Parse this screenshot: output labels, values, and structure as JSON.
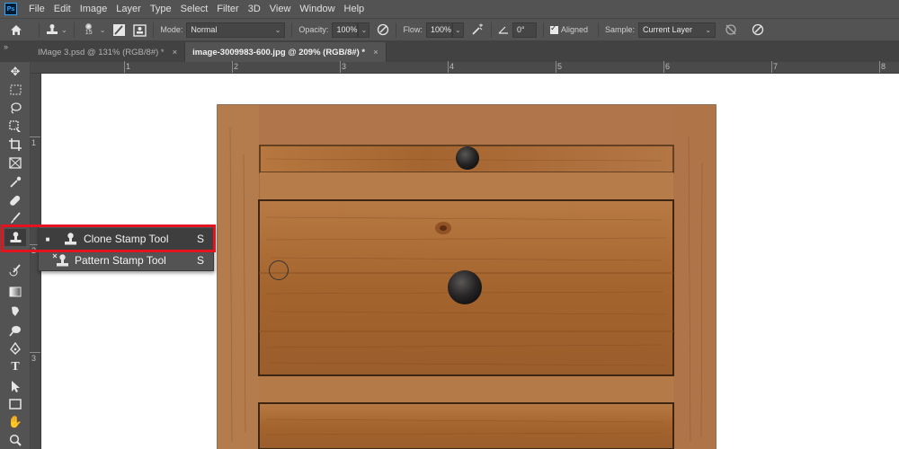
{
  "app": {
    "logo_text": "Ps"
  },
  "menu": [
    "File",
    "Edit",
    "Image",
    "Layer",
    "Type",
    "Select",
    "Filter",
    "3D",
    "View",
    "Window",
    "Help"
  ],
  "options": {
    "brush_size": "15",
    "mode_label": "Mode:",
    "mode_value": "Normal",
    "opacity_label": "Opacity:",
    "opacity_value": "100%",
    "flow_label": "Flow:",
    "flow_value": "100%",
    "angle_value": "0°",
    "aligned_label": "Aligned",
    "sample_label": "Sample:",
    "sample_value": "Current Layer"
  },
  "tabs": [
    {
      "label": "IMage 3.psd @ 131% (RGB/8#) *",
      "close": "×",
      "active": false
    },
    {
      "label": "image-3009983-600.jpg @ 209% (RGB/8#) *",
      "close": "×",
      "active": true
    }
  ],
  "tab_collapse": "»",
  "ruler": {
    "h_labels": [
      "1",
      "2",
      "3",
      "4",
      "5",
      "6",
      "7",
      "8"
    ],
    "v_labels": [
      "1",
      "2",
      "3"
    ]
  },
  "flyout": {
    "items": [
      {
        "mark": "■",
        "label": "Clone Stamp Tool",
        "shortcut": "S"
      },
      {
        "mark": "",
        "label": "Pattern Stamp Tool",
        "shortcut": "S"
      }
    ]
  },
  "colors": {
    "highlight_border": "#e3141f",
    "wood": "#a5652e"
  }
}
